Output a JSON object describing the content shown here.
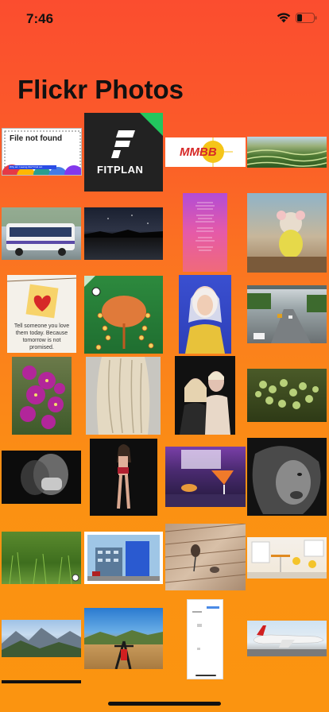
{
  "status_bar": {
    "time": "7:46"
  },
  "header": {
    "title": "Flickr Photos"
  },
  "photos": [
    {
      "id": "file-not-found",
      "caption": "File not found",
      "subcaption": "Why am I seeing this? Find out"
    },
    {
      "id": "fitplan",
      "caption": "FITPLAN"
    },
    {
      "id": "mmbb",
      "caption": "MMBB"
    },
    {
      "id": "rice-terraces"
    },
    {
      "id": "bus"
    },
    {
      "id": "night-lake"
    },
    {
      "id": "pink-poem"
    },
    {
      "id": "teddy-mouse"
    },
    {
      "id": "heart-note",
      "caption": "Tell someone you love them today. Because tomorrow is not promised."
    },
    {
      "id": "flower-art"
    },
    {
      "id": "woman-headscarf"
    },
    {
      "id": "highway"
    },
    {
      "id": "purple-flowers"
    },
    {
      "id": "blonde-hair"
    },
    {
      "id": "couple-portrait"
    },
    {
      "id": "green-berries"
    },
    {
      "id": "mask-portrait"
    },
    {
      "id": "figure-model"
    },
    {
      "id": "cocktail"
    },
    {
      "id": "lion"
    },
    {
      "id": "grass"
    },
    {
      "id": "building"
    },
    {
      "id": "wood-bird"
    },
    {
      "id": "cafe-room"
    },
    {
      "id": "mountains"
    },
    {
      "id": "bike-desert"
    },
    {
      "id": "phone-screenshot"
    },
    {
      "id": "airplane"
    }
  ]
}
